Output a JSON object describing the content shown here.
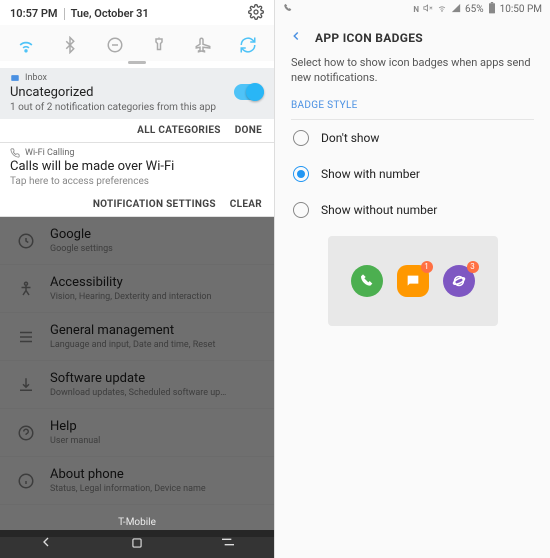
{
  "left": {
    "status_time": "10:57 PM",
    "status_date": "Tue, October 31",
    "notif1_app": "Inbox",
    "notif1_title": "Uncategorized",
    "notif1_sub": "1 out of 2 notification categories from this app",
    "act_all": "ALL CATEGORIES",
    "act_done": "DONE",
    "notif2_app": "Wi-Fi Calling",
    "notif2_title": "Calls will be made over Wi-Fi",
    "notif2_sub": "Tap here to access preferences",
    "act_settings": "NOTIFICATION SETTINGS",
    "act_clear": "CLEAR",
    "settings": [
      {
        "t": "Google",
        "s": "Google settings"
      },
      {
        "t": "Accessibility",
        "s": "Vision, Hearing, Dexterity and interaction"
      },
      {
        "t": "General management",
        "s": "Language and input, Date and time, Reset"
      },
      {
        "t": "Software update",
        "s": "Download updates, Scheduled software up…"
      },
      {
        "t": "Help",
        "s": "User manual"
      },
      {
        "t": "About phone",
        "s": "Status, Legal information, Device name"
      }
    ],
    "carrier": "T-Mobile"
  },
  "right": {
    "status_time": "10:50 PM",
    "status_battery": "65%",
    "title": "APP ICON BADGES",
    "desc": "Select how to show icon badges when apps send new notifications.",
    "section": "BADGE STYLE",
    "opt1": "Don't show",
    "opt2": "Show with number",
    "opt3": "Show without number",
    "badge1": "1",
    "badge2": "3"
  }
}
